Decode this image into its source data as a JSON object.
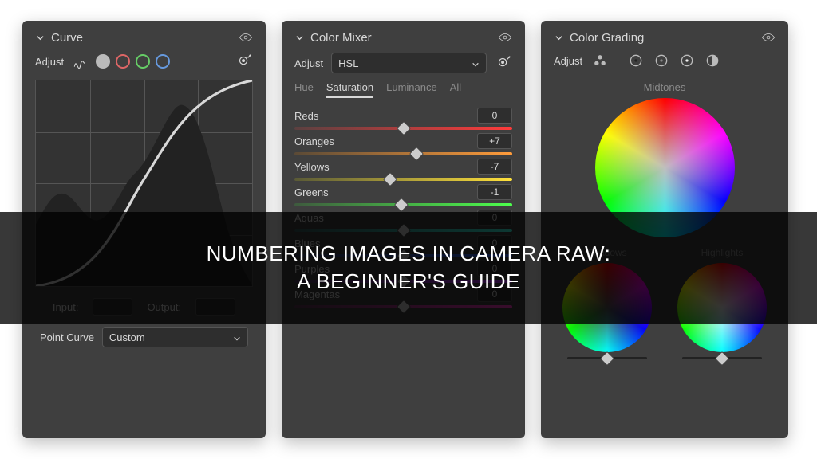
{
  "overlay": {
    "line1": "Numbering Images in Camera Raw:",
    "line2": "A Beginner's Guide"
  },
  "curve": {
    "title": "Curve",
    "adjust_label": "Adjust",
    "input_label": "Input:",
    "output_label": "Output:",
    "point_curve_label": "Point Curve",
    "point_curve_value": "Custom"
  },
  "mixer": {
    "title": "Color Mixer",
    "adjust_label": "Adjust",
    "mode_value": "HSL",
    "tabs": {
      "hue": "Hue",
      "sat": "Saturation",
      "lum": "Luminance",
      "all": "All"
    },
    "active_tab": "Saturation",
    "sliders": [
      {
        "name": "Reds",
        "value": "0",
        "pos": 50,
        "g": [
          "#5b4040",
          "#ff3b3b"
        ]
      },
      {
        "name": "Oranges",
        "value": "+7",
        "pos": 56,
        "g": [
          "#5b4a36",
          "#ff9c3b"
        ]
      },
      {
        "name": "Yellows",
        "value": "-7",
        "pos": 44,
        "g": [
          "#5a5a36",
          "#ffe13b"
        ]
      },
      {
        "name": "Greens",
        "value": "-1",
        "pos": 49,
        "g": [
          "#3e5a3e",
          "#4dff4d"
        ]
      },
      {
        "name": "Aquas",
        "value": "0",
        "pos": 50,
        "g": [
          "#365a5a",
          "#3bffe7"
        ]
      },
      {
        "name": "Blues",
        "value": "0",
        "pos": 50,
        "g": [
          "#383e5a",
          "#3b6bff"
        ]
      },
      {
        "name": "Purples",
        "value": "0",
        "pos": 50,
        "g": [
          "#4a385a",
          "#b93bff"
        ]
      },
      {
        "name": "Magentas",
        "value": "0",
        "pos": 50,
        "g": [
          "#5a3852",
          "#ff3bc7"
        ]
      }
    ]
  },
  "grading": {
    "title": "Color Grading",
    "adjust_label": "Adjust",
    "midtones_label": "Midtones",
    "shadows_label": "Shadows",
    "highlights_label": "Highlights"
  }
}
